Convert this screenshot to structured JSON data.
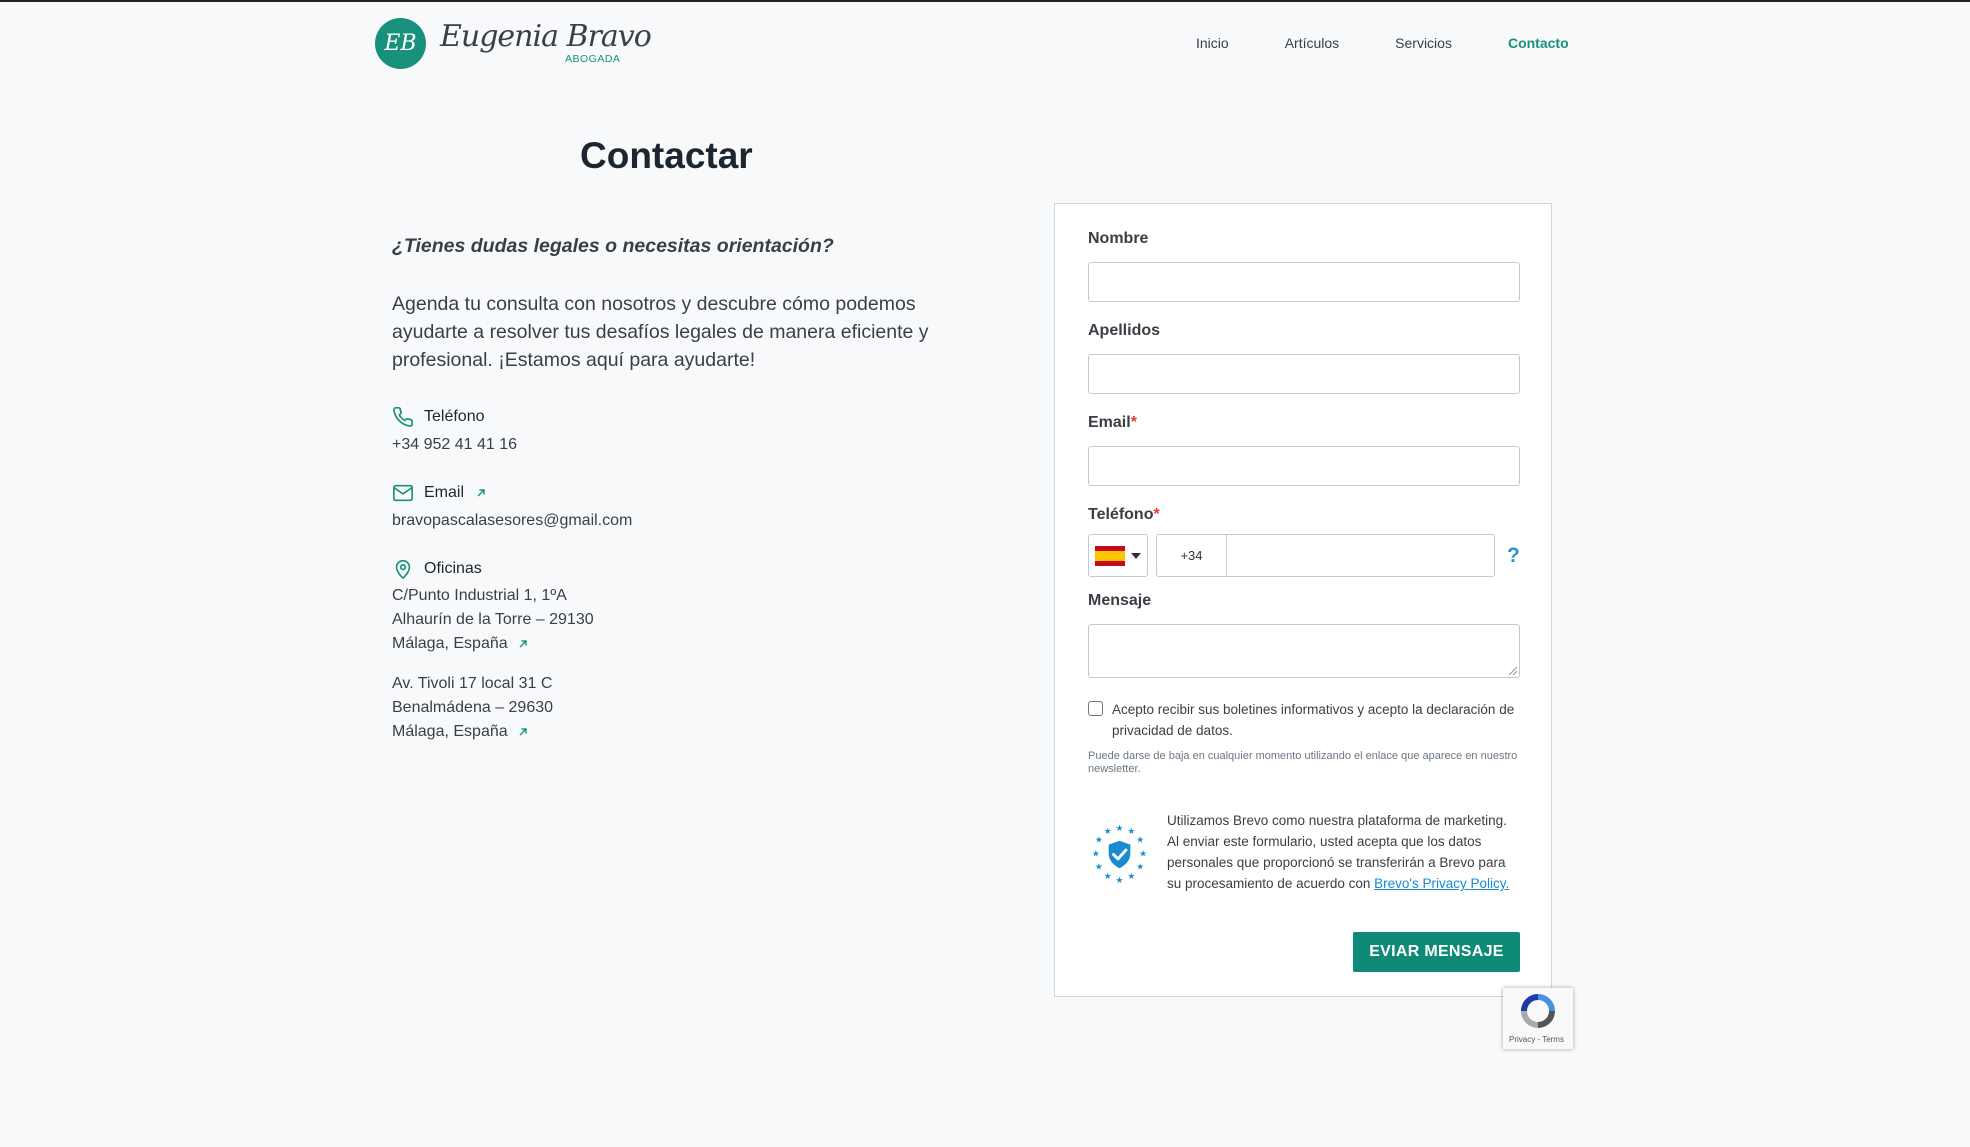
{
  "header": {
    "logo_monogram": "EB",
    "logo_name": "Eugenia Bravo",
    "logo_subtitle": "ABOGADA",
    "nav": [
      {
        "label": "Inicio"
      },
      {
        "label": "Artículos"
      },
      {
        "label": "Servicios"
      },
      {
        "label": "Contacto",
        "active": true
      }
    ]
  },
  "page": {
    "title": "Contactar",
    "question": "¿Tienes dudas legales o necesitas orientación?",
    "intro": "Agenda tu consulta con nosotros y descubre cómo podemos ayudarte a resolver tus desafíos legales de manera eficiente y profesional. ¡Estamos aquí para ayudarte!"
  },
  "contact": {
    "phone": {
      "label": "Teléfono",
      "value": "+34 952 41 41 16",
      "icon": "phone-icon"
    },
    "email": {
      "label": "Email",
      "value": "bravopascalasesores@gmail.com",
      "icon": "envelope-icon"
    },
    "offices": {
      "label": "Oficinas",
      "icon": "map-pin-icon",
      "office1": [
        "C/Punto Industrial 1, 1ºA",
        "Alhaurín de la Torre – 29130",
        "Málaga, España"
      ],
      "office2": [
        "Av. Tivoli 17 local 31 C",
        "Benalmádena – 29630",
        "Málaga, España"
      ]
    }
  },
  "form": {
    "nombre_label": "Nombre",
    "apellidos_label": "Apellidos",
    "email_label": "Email",
    "telefono_label": "Teléfono",
    "required_mark": "*",
    "dial_code": "+34",
    "help_symbol": "?",
    "mensaje_label": "Mensaje",
    "consent_text": "Acepto recibir sus boletines informativos y acepto la declaración de privacidad de datos.",
    "unsubscribe_note": "Puede darse de baja en cualquier momento utilizando el enlace que aparece en nuestro newsletter.",
    "brevo_text": "Utilizamos Brevo como nuestra plataforma de marketing. Al enviar este formulario, usted acepta que los datos personales que proporcionó se transferirán a Brevo para su procesamiento de acuerdo con ",
    "brevo_link": "Brevo's Privacy Policy.",
    "submit_label": "EVIAR MENSAJE",
    "recaptcha_text": "Privacy - Terms"
  },
  "colors": {
    "accent": "#17917c",
    "button": "#0e8a76",
    "required": "#e53935",
    "link": "#1a8ad1"
  }
}
